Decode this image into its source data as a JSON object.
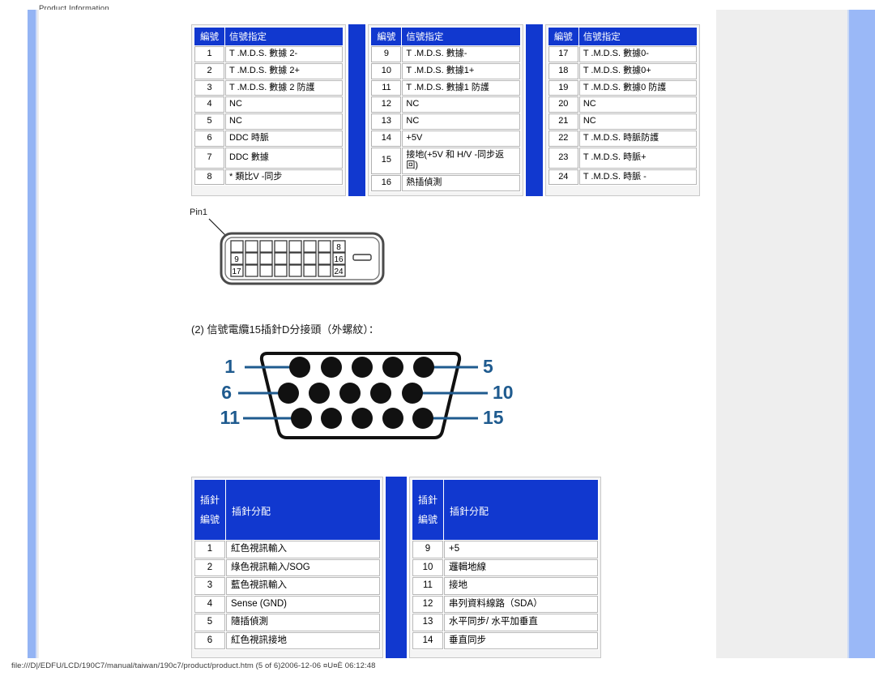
{
  "print_header": "Product Information",
  "print_footer": "file:///D|/EDFU/LCD/190C7/manual/taiwan/190c7/product/product.htm (5 of 6)2006-12-06 ¤U¤È 06:12:48",
  "colors": {
    "table_header_blue": "#1138cf",
    "separator_blue": "#1138cf",
    "page_side_blue": "#9ab8f7",
    "page_gray": "#eeeeee",
    "dsub_label_blue": "#1f5b8f"
  },
  "dvi_tables": {
    "headers": {
      "number": "編號",
      "assignment": "信號指定"
    },
    "columns": [
      {
        "rows": [
          {
            "pin": "1",
            "signal": "T .M.D.S. 數據 2-"
          },
          {
            "pin": "2",
            "signal": "T .M.D.S. 數據 2+"
          },
          {
            "pin": "3",
            "signal": "T .M.D.S. 數據 2 防護"
          },
          {
            "pin": "4",
            "signal": "NC"
          },
          {
            "pin": "5",
            "signal": "NC"
          },
          {
            "pin": "6",
            "signal": "DDC 時脈"
          },
          {
            "pin": "7",
            "signal": "DDC 數據"
          },
          {
            "pin": "8",
            "signal": "* 類比V -同步"
          }
        ]
      },
      {
        "rows": [
          {
            "pin": "9",
            "signal": "T .M.D.S. 數據-"
          },
          {
            "pin": "10",
            "signal": "T .M.D.S. 數據1+"
          },
          {
            "pin": "11",
            "signal": "T .M.D.S. 數據1 防護"
          },
          {
            "pin": "12",
            "signal": "NC"
          },
          {
            "pin": "13",
            "signal": "NC"
          },
          {
            "pin": "14",
            "signal": "+5V"
          },
          {
            "pin": "15",
            "signal": "接地(+5V 和 H/V -同步返回)"
          },
          {
            "pin": "16",
            "signal": "熱插偵測"
          }
        ]
      },
      {
        "rows": [
          {
            "pin": "17",
            "signal": "T .M.D.S. 數據0-"
          },
          {
            "pin": "18",
            "signal": "T .M.D.S. 數據0+"
          },
          {
            "pin": "19",
            "signal": "T .M.D.S. 數據0 防護"
          },
          {
            "pin": "20",
            "signal": "NC"
          },
          {
            "pin": "21",
            "signal": "NC"
          },
          {
            "pin": "22",
            "signal": "T .M.D.S. 時脈防護"
          },
          {
            "pin": "23",
            "signal": "T .M.D.S. 時脈+"
          },
          {
            "pin": "24",
            "signal": "T .M.D.S. 時脈 -"
          }
        ]
      }
    ]
  },
  "dvi_diagram": {
    "pin1_label": "Pin1",
    "pin_markers": [
      "8",
      "9",
      "16",
      "17",
      "24"
    ]
  },
  "caption": "(2) 信號電纜15插針D分接頭（外螺紋）：",
  "dsub_diagram": {
    "left_labels": [
      "1",
      "6",
      "11"
    ],
    "right_labels": [
      "5",
      "10",
      "15"
    ]
  },
  "vga_tables": {
    "headers": {
      "number_line1": "插針",
      "number_line2": "編號",
      "assignment": "插針分配"
    },
    "columns": [
      {
        "rows": [
          {
            "pin": "1",
            "signal": "紅色視訊輸入"
          },
          {
            "pin": "2",
            "signal": "綠色視訊輸入/SOG"
          },
          {
            "pin": "3",
            "signal": "藍色視訊輸入"
          },
          {
            "pin": "4",
            "signal": "Sense (GND)"
          },
          {
            "pin": "5",
            "signal": "隨插偵測"
          },
          {
            "pin": "6",
            "signal": "紅色視訊接地"
          }
        ]
      },
      {
        "rows": [
          {
            "pin": "9",
            "signal": "+5"
          },
          {
            "pin": "10",
            "signal": "邏輯地線"
          },
          {
            "pin": "11",
            "signal": "接地"
          },
          {
            "pin": "12",
            "signal": "串列資料線路（SDA）"
          },
          {
            "pin": "13",
            "signal": "水平同步/ 水平加垂直"
          },
          {
            "pin": "14",
            "signal": "垂直同步"
          }
        ]
      }
    ]
  }
}
